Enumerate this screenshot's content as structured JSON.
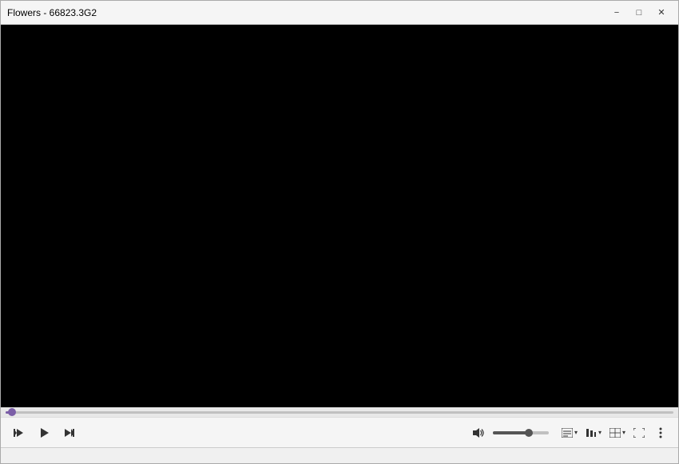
{
  "titlebar": {
    "title": "Flowers - 66823.3G2",
    "minimize_label": "−",
    "maximize_label": "□",
    "close_label": "✕"
  },
  "video": {
    "background_color": "#000000"
  },
  "seekbar": {
    "progress_percent": 1
  },
  "controls": {
    "prev_label": "⏮",
    "play_label": "▶",
    "next_label": "⏭",
    "volume_percent": 65
  },
  "right_controls": {
    "subtitles_label": "CC",
    "audio_label": "♪",
    "display_label": "⊞",
    "fullscreen_label": "⛶"
  },
  "statusbar": {
    "text": ""
  }
}
